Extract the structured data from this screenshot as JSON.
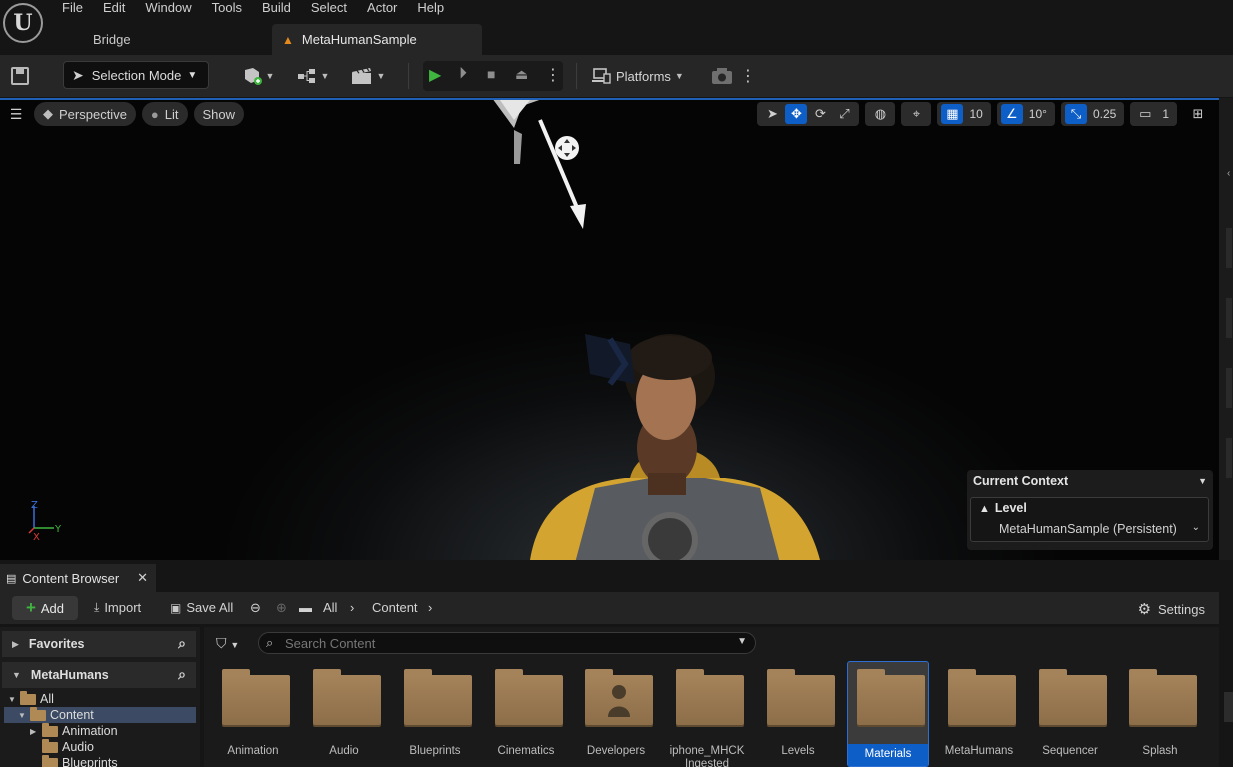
{
  "menus": [
    "File",
    "Edit",
    "Window",
    "Tools",
    "Build",
    "Select",
    "Actor",
    "Help"
  ],
  "tabs": {
    "bridge": "Bridge",
    "active": "MetaHumanSample"
  },
  "toolbar": {
    "mode": "Selection Mode",
    "platforms": "Platforms"
  },
  "viewport": {
    "perspective": "Perspective",
    "lit": "Lit",
    "show": "Show",
    "grid_snap": "10",
    "rotation_snap": "10°",
    "scale_snap": "0.25",
    "camera_speed": "1",
    "axis_z": "Z",
    "axis_y": "Y",
    "axis_x": "X"
  },
  "context": {
    "title": "Current Context",
    "level_label": "Level",
    "level_value": "MetaHumanSample (Persistent)"
  },
  "content_browser": {
    "tab_title": "Content Browser",
    "add": "Add",
    "import": "Import",
    "save_all": "Save All",
    "path_all": "All",
    "path_content": "Content",
    "settings": "Settings",
    "search_placeholder": "Search Content",
    "favorites": "Favorites",
    "collection": "MetaHumans",
    "tree": [
      "All",
      "Content",
      "Animation",
      "Audio",
      "Blueprints"
    ],
    "assets": [
      "Animation",
      "Audio",
      "Blueprints",
      "Cinematics",
      "Developers",
      "iphone_MHCK Ingested",
      "Levels",
      "Materials",
      "MetaHumans",
      "Sequencer",
      "Splash"
    ]
  },
  "colors": {
    "accent": "#0e5ec7",
    "folder": "#a5835a",
    "play": "#3fb43f"
  }
}
